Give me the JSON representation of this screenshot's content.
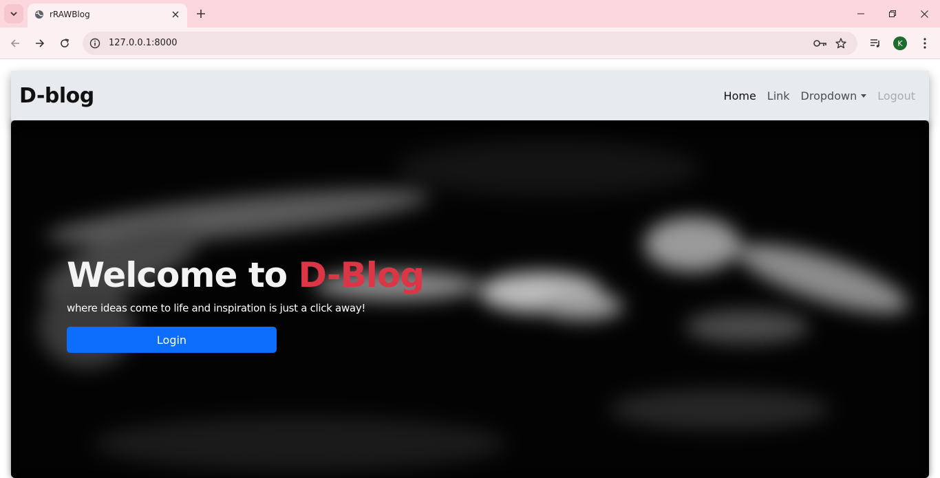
{
  "browser": {
    "tab_title": "rRAWBlog",
    "url": "127.0.0.1:8000",
    "profile_initial": "K",
    "accent": "#fcd7dd"
  },
  "navbar": {
    "brand": "D-blog",
    "links": {
      "home": "Home",
      "link": "Link",
      "dropdown": "Dropdown",
      "logout": "Logout"
    }
  },
  "hero": {
    "title_prefix": "Welcome to ",
    "title_accent": "D-Blog",
    "subtitle": "where ideas come to life and inspiration is just a click away!",
    "login_label": "Login",
    "accent_color": "#dc3545",
    "button_color": "#0d6efd"
  }
}
